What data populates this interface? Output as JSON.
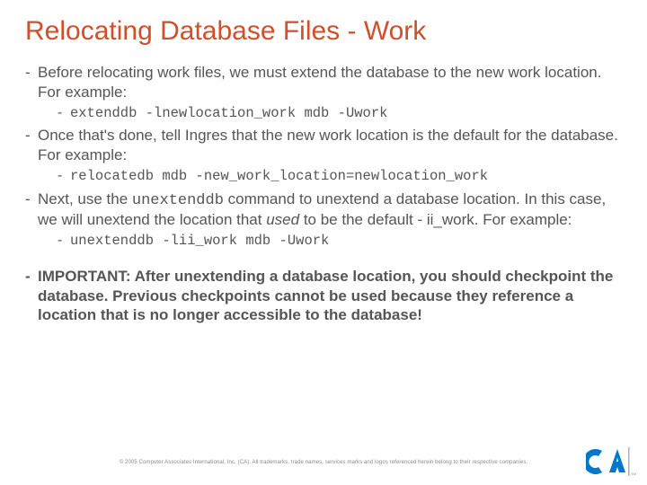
{
  "title": "Relocating Database Files - Work",
  "bullets": {
    "b1_pre": "Before relocating work files, we must extend the database to the new work location.  For example:",
    "b1_cmd": "extenddb -lnewlocation_work mdb -Uwork",
    "b2_pre": "Once that's done, tell Ingres that the new work location is the default for the database.  For example:",
    "b2_cmd": "relocatedb mdb -new_work_location=newlocation_work",
    "b3_a": "Next, use the ",
    "b3_code": "unextenddb",
    "b3_b": " command to unextend a database location.  In this case, we will unextend the location that ",
    "b3_italic": "used",
    "b3_c": " to be the default - ii_work.  For example:",
    "b3_cmd": "unextenddb -lii_work mdb -Uwork",
    "b4": "IMPORTANT: After unextending a database location, you should checkpoint the database.  Previous checkpoints cannot be used because they reference a location that is no longer accessible to the database!"
  },
  "footer": "© 2005 Computer Associates International, Inc. (CA). All trademarks, trade names, services marks and logos referenced herein belong to their respective companies.",
  "colors": {
    "title": "#d14f2a",
    "logo_blue": "#0077c8",
    "logo_sep": "#b0b0b0"
  }
}
